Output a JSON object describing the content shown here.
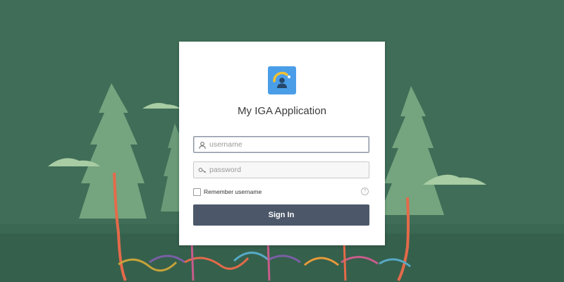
{
  "app": {
    "title": "My IGA Application",
    "logo_icon": "user-gauge-icon"
  },
  "login": {
    "username_placeholder": "username",
    "username_value": "",
    "password_placeholder": "password",
    "password_value": "",
    "remember_label": "Remember username",
    "remember_checked": false,
    "help_icon": "question-circle-icon",
    "sign_in_label": "Sign In"
  },
  "theme": {
    "background": "#3d6b55",
    "button": "#4c5869",
    "logo_bg": "#4a9ee8",
    "tree": "#74a57f"
  }
}
